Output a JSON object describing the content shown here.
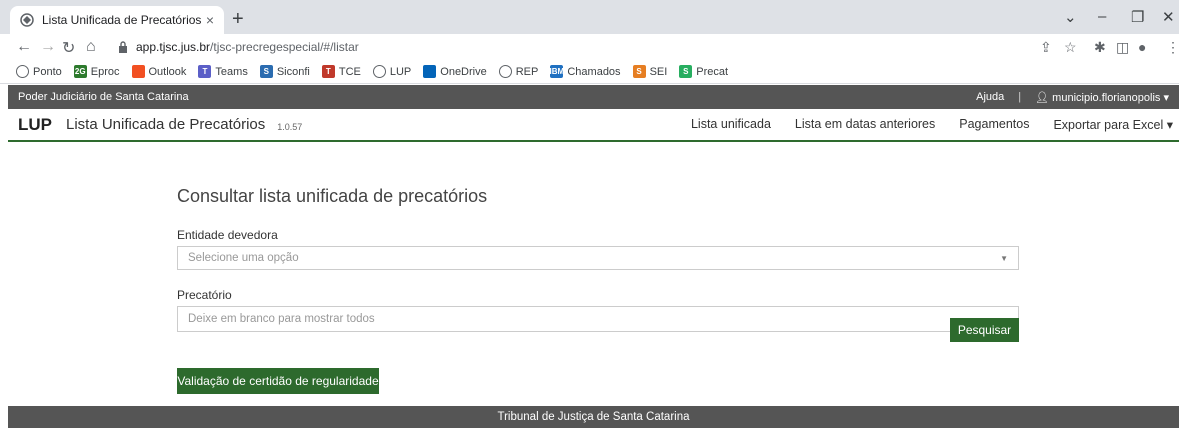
{
  "browser": {
    "tab_title": "Lista Unificada de Precatórios",
    "tab_close": "×",
    "new_tab": "+",
    "url_host": "app.tjsc.jus.br",
    "url_path": "/tjsc-precregespecial/#/listar",
    "bookmarks": [
      {
        "label": "Ponto",
        "icon": "globe-icon",
        "color": "#5f6368",
        "glyph": ""
      },
      {
        "label": "Eproc",
        "icon": "eproc-icon",
        "color": "#2d7a2d",
        "glyph": "2G"
      },
      {
        "label": "Outlook",
        "icon": "outlook-icon",
        "color": "#f25022",
        "glyph": ""
      },
      {
        "label": "Teams",
        "icon": "teams-icon",
        "color": "#5b5fc7",
        "glyph": "T"
      },
      {
        "label": "Siconfi",
        "icon": "siconfi-icon",
        "color": "#2b6cb0",
        "glyph": "S"
      },
      {
        "label": "TCE",
        "icon": "tce-icon",
        "color": "#c0392b",
        "glyph": "T"
      },
      {
        "label": "LUP",
        "icon": "globe-icon",
        "color": "#5f6368",
        "glyph": ""
      },
      {
        "label": "OneDrive",
        "icon": "onedrive-icon",
        "color": "#0364b8",
        "glyph": ""
      },
      {
        "label": "REP",
        "icon": "globe-icon",
        "color": "#5f6368",
        "glyph": ""
      },
      {
        "label": "Chamados",
        "icon": "ibm-icon",
        "color": "#1f70c1",
        "glyph": "IBM"
      },
      {
        "label": "SEI",
        "icon": "sei-icon",
        "color": "#e67e22",
        "glyph": "S"
      },
      {
        "label": "Precat",
        "icon": "precat-icon",
        "color": "#27ae60",
        "glyph": "S"
      }
    ]
  },
  "topbar": {
    "org": "Poder Judiciário de Santa Catarina",
    "help": "Ajuda",
    "separator": "|",
    "user": "municipio.florianopolis"
  },
  "appnav": {
    "brand": "LUP",
    "title": "Lista Unificada de Precatórios",
    "version": "1.0.57",
    "menu": [
      "Lista unificada",
      "Lista em datas anteriores",
      "Pagamentos",
      "Exportar para Excel"
    ]
  },
  "form": {
    "heading": "Consultar lista unificada de precatórios",
    "entity_label": "Entidade devedora",
    "entity_placeholder": "Selecione uma opção",
    "precatorio_label": "Precatório",
    "precatorio_placeholder": "Deixe em branco para mostrar todos",
    "search_button": "Pesquisar",
    "validate_button": "Validação de certidão de regularidade"
  },
  "footer": {
    "text": "Tribunal de Justiça de Santa Catarina"
  }
}
